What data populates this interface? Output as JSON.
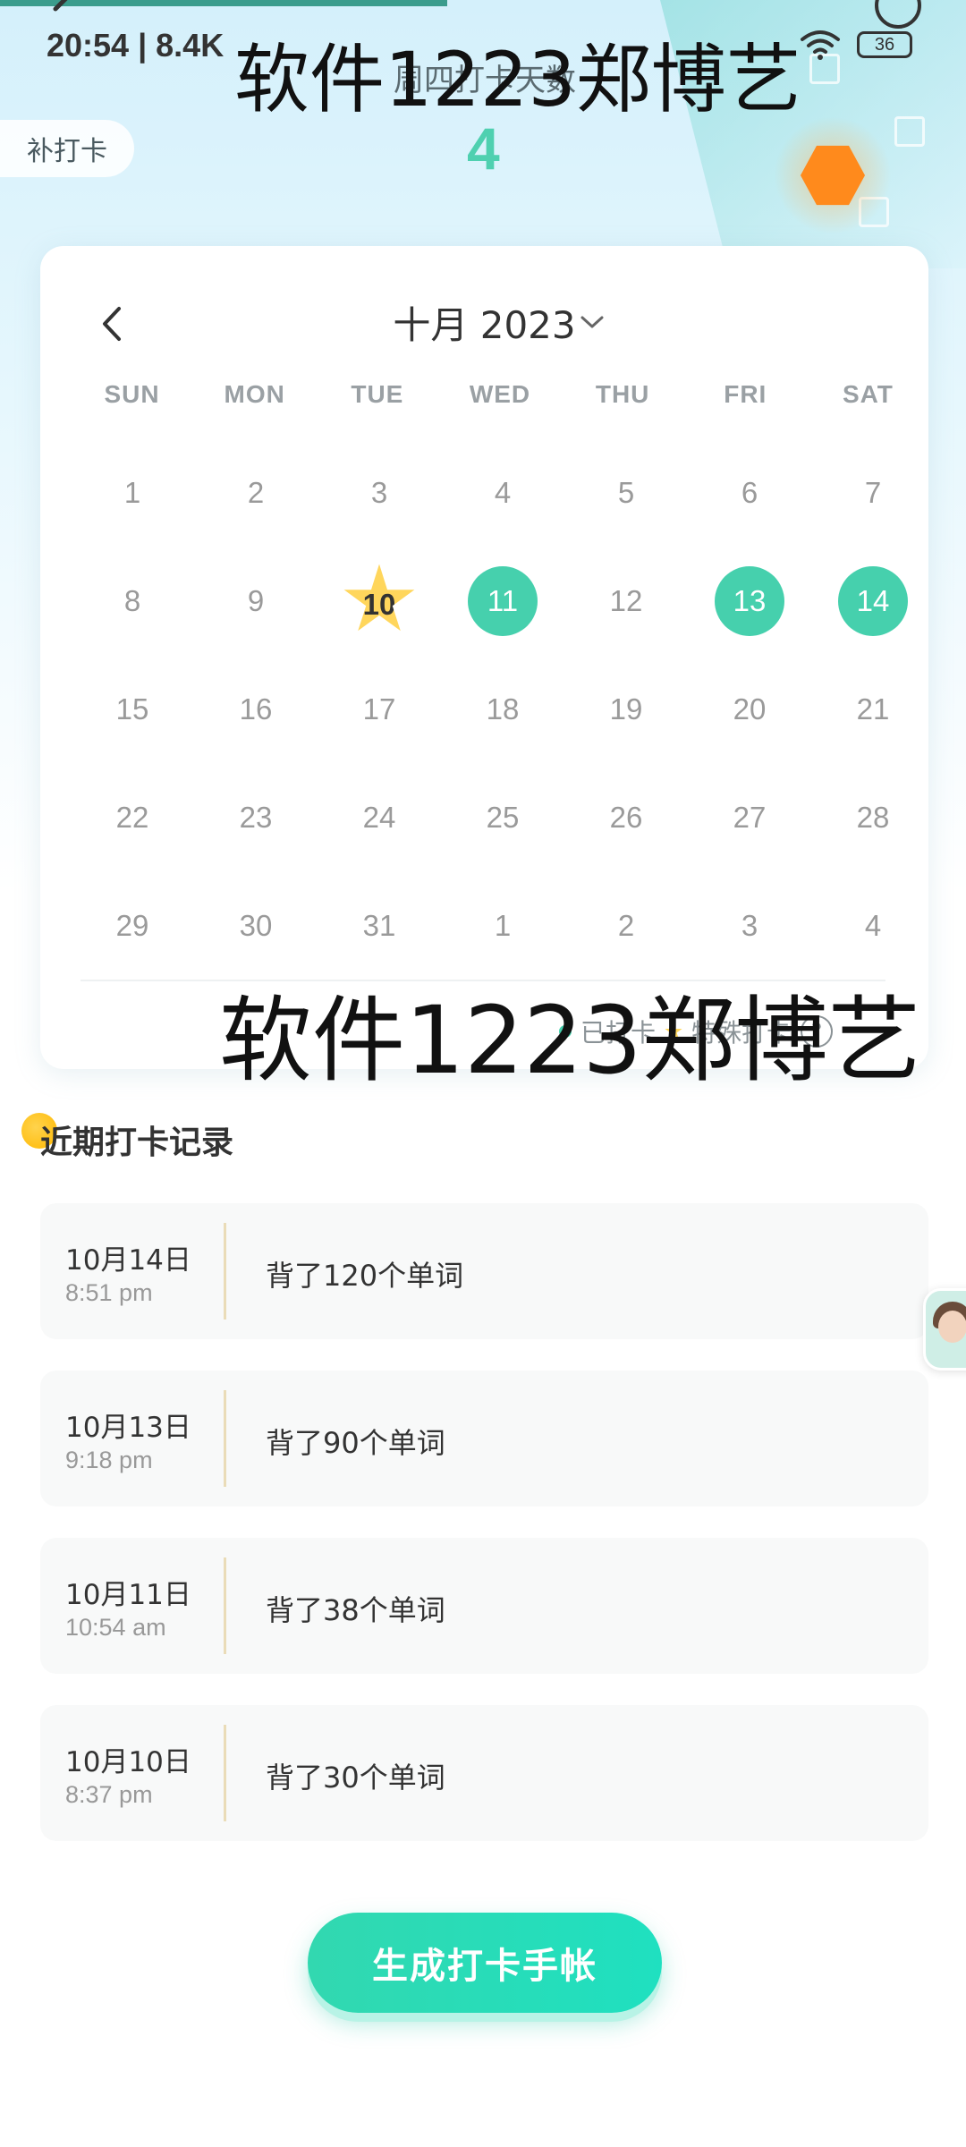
{
  "status_bar": {
    "time": "20:54 | 8.4K",
    "battery": "36"
  },
  "watermark": {
    "top": "软件1223郑博艺",
    "middle": "软件1223郑博艺"
  },
  "header": {
    "label": "周四打卡天数",
    "count": "4",
    "makeup_button": "补打卡"
  },
  "calendar": {
    "title": "十月 2023",
    "weekdays": [
      "SUN",
      "MON",
      "TUE",
      "WED",
      "THU",
      "FRI",
      "SAT"
    ],
    "rows": [
      [
        "1",
        "2",
        "3",
        "4",
        "5",
        "6",
        "7"
      ],
      [
        "8",
        "9",
        "10",
        "11",
        "12",
        "13",
        "14"
      ],
      [
        "15",
        "16",
        "17",
        "18",
        "19",
        "20",
        "21"
      ],
      [
        "22",
        "23",
        "24",
        "25",
        "26",
        "27",
        "28"
      ],
      [
        "29",
        "30",
        "31",
        "1",
        "2",
        "3",
        "4"
      ]
    ],
    "special_day": "10",
    "checked_days": [
      "11",
      "13",
      "14"
    ],
    "legend": {
      "checked": "已打卡",
      "special": "特殊打卡"
    },
    "colors": {
      "checked": "#46d0ad",
      "special": "#ffd65c"
    }
  },
  "recent": {
    "title": "近期打卡记录",
    "records": [
      {
        "date": "10月14日",
        "time": "8:51 pm",
        "text": "背了120个单词"
      },
      {
        "date": "10月13日",
        "time": "9:18 pm",
        "text": "背了90个单词"
      },
      {
        "date": "10月11日",
        "time": "10:54 am",
        "text": "背了38个单词"
      },
      {
        "date": "10月10日",
        "time": "8:37 pm",
        "text": "背了30个单词"
      }
    ]
  },
  "generate_button": "生成打卡手帐"
}
